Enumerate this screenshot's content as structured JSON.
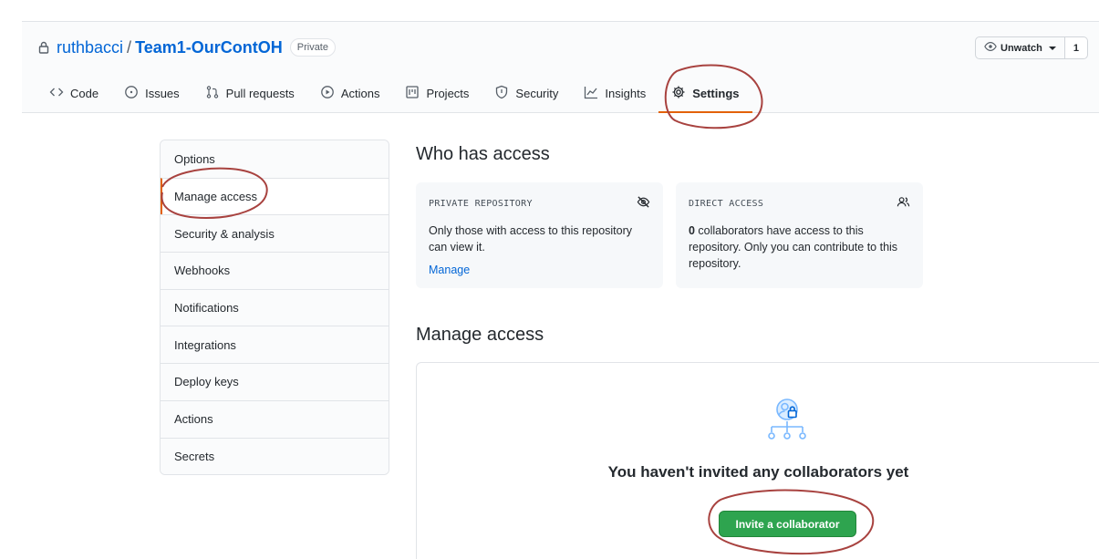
{
  "repo": {
    "owner": "ruthbacci",
    "separator": "/",
    "name": "Team1-OurContOH",
    "visibility": "Private"
  },
  "watch": {
    "label": "Unwatch",
    "count": "1"
  },
  "tabs": [
    {
      "label": "Code",
      "icon": "code-icon"
    },
    {
      "label": "Issues",
      "icon": "issue-icon"
    },
    {
      "label": "Pull requests",
      "icon": "pull-request-icon"
    },
    {
      "label": "Actions",
      "icon": "play-icon"
    },
    {
      "label": "Projects",
      "icon": "project-icon"
    },
    {
      "label": "Security",
      "icon": "shield-icon"
    },
    {
      "label": "Insights",
      "icon": "graph-icon"
    },
    {
      "label": "Settings",
      "icon": "gear-icon",
      "selected": true
    }
  ],
  "sidebar": {
    "items": [
      {
        "label": "Options"
      },
      {
        "label": "Manage access",
        "active": true
      },
      {
        "label": "Security & analysis"
      },
      {
        "label": "Webhooks"
      },
      {
        "label": "Notifications"
      },
      {
        "label": "Integrations"
      },
      {
        "label": "Deploy keys"
      },
      {
        "label": "Actions"
      },
      {
        "label": "Secrets"
      }
    ]
  },
  "who_has_access": {
    "heading": "Who has access",
    "private_box": {
      "title": "PRIVATE REPOSITORY",
      "text": "Only those with access to this repository can view it.",
      "link": "Manage"
    },
    "direct_box": {
      "title": "DIRECT ACCESS",
      "count": "0",
      "text": " collaborators have access to this repository. Only you can contribute to this repository."
    }
  },
  "manage_access": {
    "heading": "Manage access",
    "empty_title": "You haven't invited any collaborators yet",
    "invite_button": "Invite a collaborator"
  },
  "colors": {
    "link": "#0366d6",
    "tab_underline": "#e36209",
    "primary_button": "#2ea44f",
    "annotation": "#a8423f"
  }
}
